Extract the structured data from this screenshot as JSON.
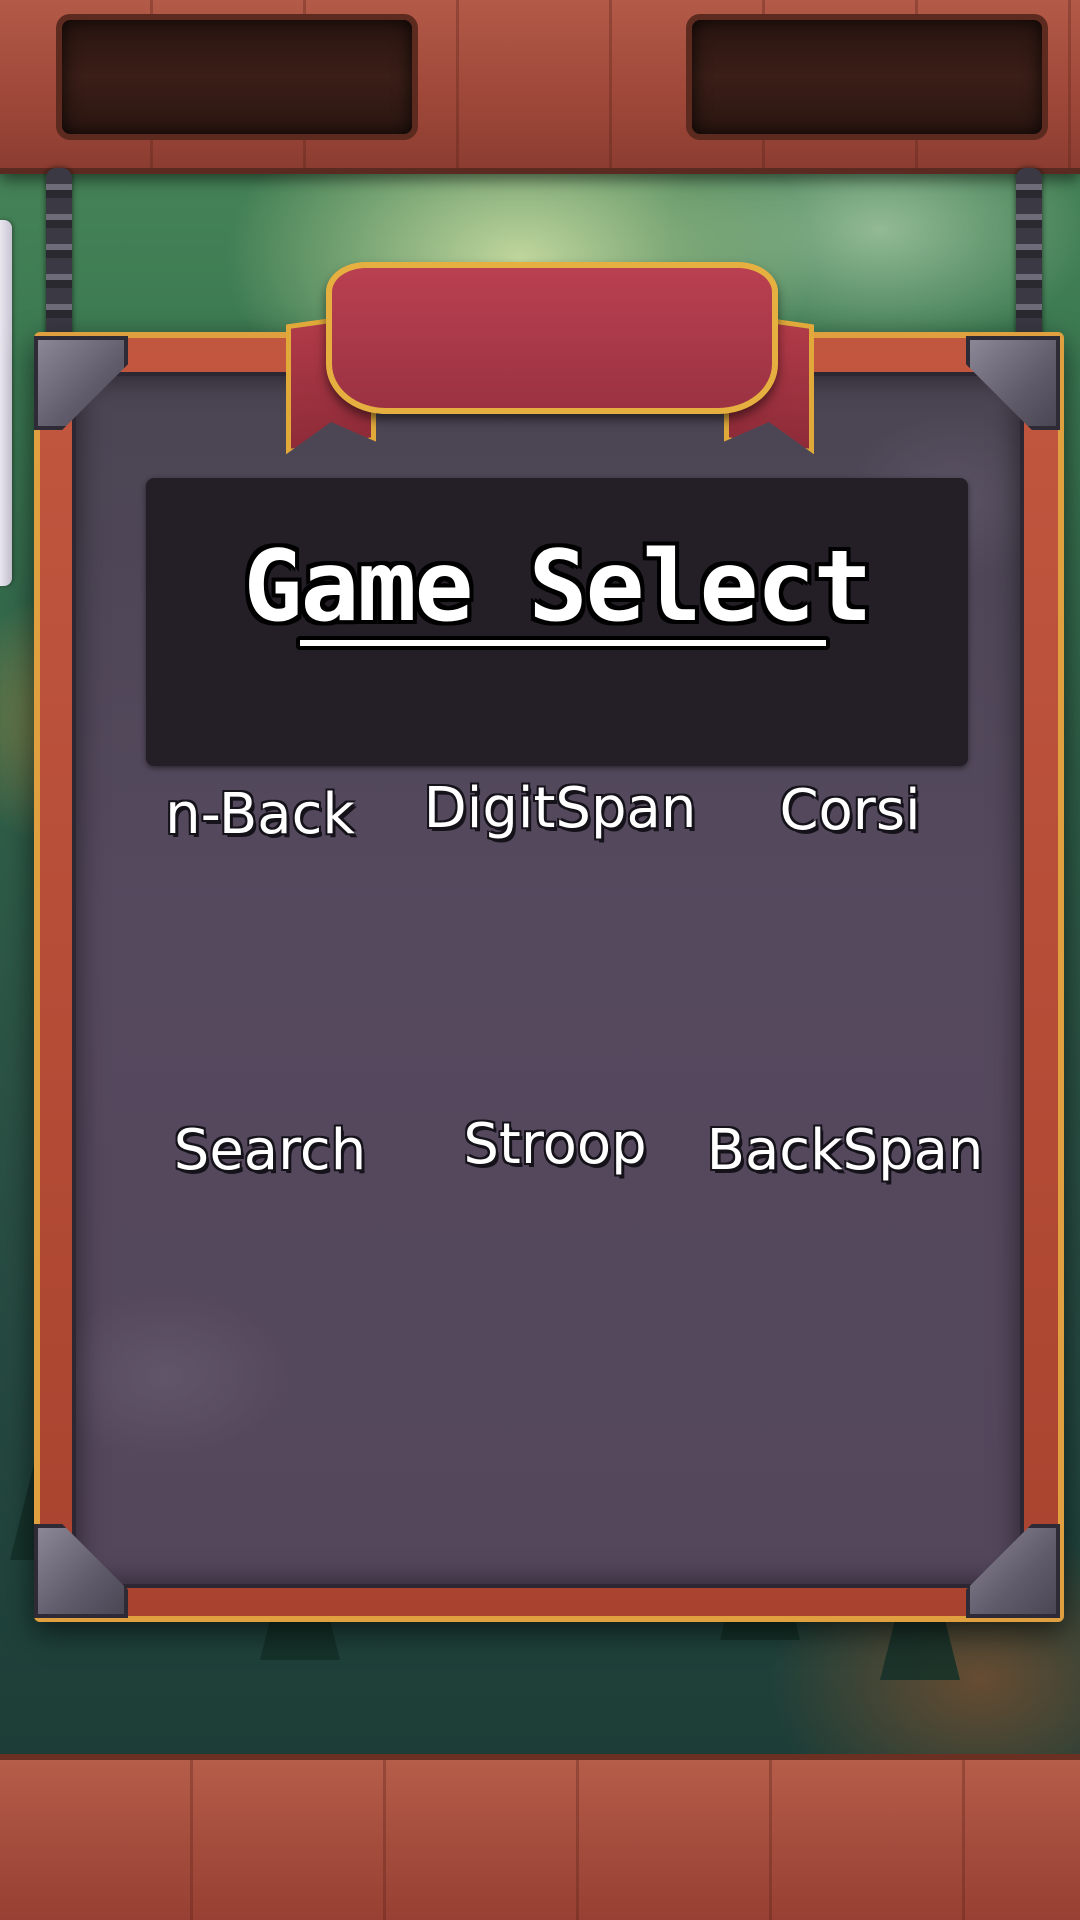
{
  "header": {
    "left_slot": "",
    "right_slot": ""
  },
  "title_panel": {
    "title": "Game Select"
  },
  "games": [
    {
      "label": "n-Back"
    },
    {
      "label": "DigitSpan"
    },
    {
      "label": "Corsi"
    },
    {
      "label": "Search"
    },
    {
      "label": "Stroop"
    },
    {
      "label": "BackSpan"
    }
  ],
  "colors": {
    "wood": "#a0493a",
    "stone": "#54475c",
    "ribbon": "#9b3242",
    "gold_trim": "#e6b040",
    "title_panel": "#241e26",
    "text": "#ffffff"
  }
}
